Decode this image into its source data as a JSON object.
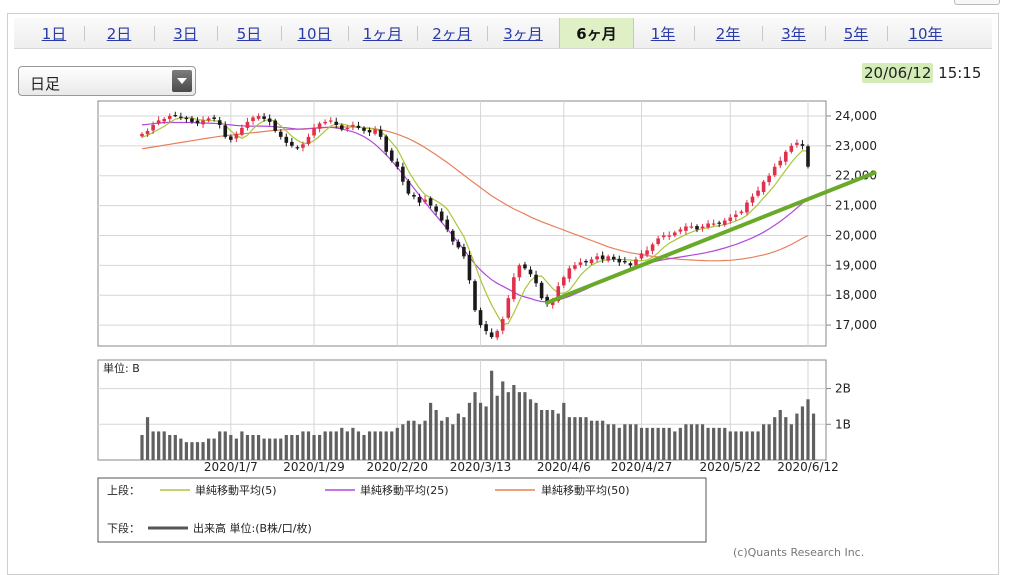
{
  "tabs": [
    {
      "label": "1日",
      "active": false
    },
    {
      "label": "2日",
      "active": false
    },
    {
      "label": "3日",
      "active": false
    },
    {
      "label": "5日",
      "active": false
    },
    {
      "label": "10日",
      "active": false
    },
    {
      "label": "1ヶ月",
      "active": false
    },
    {
      "label": "2ヶ月",
      "active": false
    },
    {
      "label": "3ヶ月",
      "active": false
    },
    {
      "label": "6ヶ月",
      "active": true
    },
    {
      "label": "1年",
      "active": false
    },
    {
      "label": "2年",
      "active": false
    },
    {
      "label": "3年",
      "active": false
    },
    {
      "label": "5年",
      "active": false
    },
    {
      "label": "10年",
      "active": false
    }
  ],
  "period_select": {
    "value": "日足"
  },
  "timestamp": {
    "date": "20/06/12",
    "time": "15:15"
  },
  "copyright": "(c)Quants Research Inc.",
  "colors": {
    "up_candle": "#e0304a",
    "down_candle": "#1a1a1a",
    "ma5": "#a8c83a",
    "ma25": "#b04ad8",
    "ma50": "#e8805a",
    "trendline": "#6aaa2a",
    "volume_bar": "#606060",
    "active_tab": "#dff0c6"
  },
  "legend": {
    "upper_label": "上段：",
    "lower_label": "下段：",
    "ma5_label": "単純移動平均(5)",
    "ma25_label": "単純移動平均(25)",
    "ma50_label": "単純移動平均(50)",
    "volume_label": "出来高 単位:(B株/口/枚)"
  },
  "chart_data": [
    {
      "type": "candlestick",
      "ylim": [
        16300,
        24500
      ],
      "yticks": [
        "24,000",
        "23,000",
        "22,000",
        "21,000",
        "20,000",
        "19,000",
        "18,000",
        "17,000"
      ],
      "ytick_values": [
        24000,
        23000,
        22000,
        21000,
        20000,
        19000,
        18000,
        17000
      ],
      "xtick_labels": [
        "2020/1/7",
        "2020/1/29",
        "2020/2/20",
        "2020/3/13",
        "2020/4/6",
        "2020/4/27",
        "2020/5/22",
        "2020/6/12"
      ],
      "xtick_index": [
        16,
        31,
        46,
        61,
        76,
        90,
        106,
        120
      ],
      "series_close": [
        23400,
        23500,
        23700,
        23850,
        23900,
        24000,
        24020,
        23950,
        23900,
        23800,
        23750,
        23850,
        23920,
        23900,
        23700,
        23300,
        23200,
        23400,
        23600,
        23800,
        23950,
        24000,
        23900,
        23800,
        23500,
        23300,
        23100,
        23000,
        22950,
        23050,
        23300,
        23600,
        23750,
        23800,
        23850,
        23700,
        23550,
        23600,
        23700,
        23600,
        23500,
        23450,
        23550,
        23300,
        22800,
        22500,
        22300,
        21800,
        21400,
        21300,
        21100,
        21200,
        21000,
        20800,
        20500,
        20200,
        19800,
        19600,
        19300,
        18500,
        17500,
        17000,
        16800,
        16600,
        16800,
        17200,
        17900,
        18600,
        19000,
        18900,
        18700,
        18400,
        17900,
        17700,
        17800,
        18300,
        18600,
        18900,
        19000,
        19100,
        19100,
        19200,
        19300,
        19200,
        19300,
        19200,
        19100,
        19100,
        19000,
        19200,
        19400,
        19500,
        19700,
        19900,
        20000,
        20000,
        20100,
        20200,
        20300,
        20300,
        20200,
        20300,
        20400,
        20400,
        20400,
        20500,
        20600,
        20700,
        20800,
        21100,
        21300,
        21500,
        21800,
        22000,
        22300,
        22500,
        22800,
        23000,
        23100,
        23000,
        22300
      ],
      "ma5": [
        23300,
        23350,
        23450,
        23550,
        23650,
        23780,
        23890,
        23930,
        23950,
        23930,
        23880,
        23860,
        23840,
        23840,
        23820,
        23690,
        23500,
        23350,
        23250,
        23350,
        23570,
        23730,
        23840,
        23880,
        23820,
        23670,
        23500,
        23320,
        23180,
        23090,
        23080,
        23170,
        23330,
        23500,
        23660,
        23740,
        23730,
        23690,
        23650,
        23630,
        23600,
        23570,
        23560,
        23480,
        23320,
        23110,
        22890,
        22540,
        22160,
        21860,
        21580,
        21360,
        21260,
        21160,
        21040,
        20880,
        20580,
        20270,
        19960,
        19500,
        19030,
        18510,
        18070,
        17680,
        17340,
        17020,
        17060,
        17400,
        17810,
        18210,
        18480,
        18640,
        18640,
        18440,
        18220,
        18080,
        18060,
        18160,
        18410,
        18670,
        18850,
        19000,
        19100,
        19160,
        19190,
        19200,
        19200,
        19190,
        19180,
        19150,
        19150,
        19180,
        19270,
        19420,
        19600,
        19740,
        19840,
        19940,
        20030,
        20110,
        20180,
        20230,
        20260,
        20300,
        20330,
        20360,
        20420,
        20480,
        20560,
        20670,
        20860,
        21040,
        21260,
        21460,
        21680,
        21940,
        22190,
        22440,
        22660,
        22840,
        22820
      ],
      "ma25": [
        23700,
        23720,
        23740,
        23760,
        23780,
        23780,
        23780,
        23780,
        23780,
        23780,
        23770,
        23760,
        23760,
        23750,
        23740,
        23720,
        23700,
        23680,
        23670,
        23660,
        23660,
        23660,
        23660,
        23650,
        23640,
        23620,
        23600,
        23580,
        23560,
        23560,
        23570,
        23590,
        23610,
        23620,
        23620,
        23600,
        23560,
        23520,
        23470,
        23400,
        23310,
        23190,
        23050,
        22880,
        22700,
        22500,
        22280,
        22050,
        21820,
        21580,
        21340,
        21110,
        20880,
        20660,
        20440,
        20220,
        19990,
        19760,
        19520,
        19280,
        19040,
        18840,
        18670,
        18520,
        18400,
        18300,
        18200,
        18100,
        18000,
        17940,
        17890,
        17830,
        17790,
        17780,
        17800,
        17840,
        17900,
        17960,
        18040,
        18120,
        18200,
        18290,
        18380,
        18480,
        18570,
        18650,
        18730,
        18810,
        18880,
        18940,
        19000,
        19060,
        19110,
        19150,
        19190,
        19220,
        19250,
        19280,
        19310,
        19340,
        19370,
        19400,
        19440,
        19480,
        19530,
        19580,
        19640,
        19700,
        19770,
        19840,
        19920,
        20010,
        20110,
        20220,
        20340,
        20470,
        20610,
        20760,
        20920,
        21080,
        21230
      ],
      "ma50": [
        22900,
        22930,
        22960,
        22990,
        23020,
        23050,
        23080,
        23110,
        23140,
        23170,
        23200,
        23230,
        23260,
        23290,
        23320,
        23340,
        23360,
        23380,
        23400,
        23420,
        23440,
        23460,
        23480,
        23500,
        23520,
        23530,
        23540,
        23550,
        23560,
        23570,
        23580,
        23590,
        23600,
        23610,
        23620,
        23630,
        23630,
        23630,
        23630,
        23620,
        23610,
        23590,
        23570,
        23540,
        23500,
        23450,
        23390,
        23320,
        23240,
        23150,
        23050,
        22940,
        22820,
        22700,
        22570,
        22440,
        22300,
        22160,
        22020,
        21880,
        21740,
        21600,
        21460,
        21330,
        21210,
        21100,
        20990,
        20890,
        20800,
        20710,
        20620,
        20540,
        20460,
        20390,
        20320,
        20250,
        20180,
        20110,
        20040,
        19970,
        19900,
        19830,
        19760,
        19690,
        19620,
        19560,
        19510,
        19460,
        19420,
        19390,
        19360,
        19330,
        19300,
        19280,
        19260,
        19240,
        19220,
        19200,
        19190,
        19180,
        19170,
        19160,
        19150,
        19150,
        19150,
        19160,
        19170,
        19190,
        19210,
        19240,
        19270,
        19310,
        19350,
        19400,
        19460,
        19530,
        19610,
        19700,
        19800,
        19900,
        20000
      ],
      "trendline": {
        "from": {
          "index": 73,
          "value": 17750
        },
        "to": {
          "index": 132,
          "value": 22100
        }
      }
    },
    {
      "type": "bar",
      "title": "単位: B",
      "ylim": [
        0,
        2.8
      ],
      "yticks": [
        "2B",
        "1B"
      ],
      "ytick_values": [
        2,
        1
      ],
      "values": [
        0.7,
        1.2,
        0.8,
        0.8,
        0.8,
        0.7,
        0.7,
        0.6,
        0.5,
        0.5,
        0.5,
        0.5,
        0.6,
        0.6,
        0.8,
        0.8,
        0.7,
        0.6,
        0.8,
        0.7,
        0.7,
        0.7,
        0.6,
        0.6,
        0.6,
        0.6,
        0.7,
        0.7,
        0.7,
        0.8,
        0.8,
        0.7,
        0.7,
        0.8,
        0.8,
        0.8,
        0.9,
        0.8,
        0.9,
        0.8,
        0.7,
        0.8,
        0.8,
        0.8,
        0.8,
        0.8,
        0.9,
        1.0,
        1.1,
        1.1,
        1.0,
        1.1,
        1.6,
        1.4,
        1.1,
        1.2,
        1.0,
        1.3,
        1.2,
        1.6,
        1.9,
        1.6,
        1.5,
        2.5,
        1.8,
        2.2,
        1.9,
        2.1,
        1.9,
        1.9,
        1.7,
        1.6,
        1.4,
        1.4,
        1.4,
        1.3,
        1.6,
        1.2,
        1.2,
        1.2,
        1.2,
        1.1,
        1.1,
        1.1,
        1.0,
        1.0,
        0.9,
        1.0,
        1.0,
        1.0,
        0.9,
        0.9,
        0.9,
        0.9,
        0.9,
        0.9,
        0.8,
        0.9,
        1.0,
        1.0,
        1.0,
        1.0,
        0.9,
        0.9,
        0.9,
        0.9,
        0.8,
        0.8,
        0.8,
        0.8,
        0.8,
        0.8,
        1.0,
        1.0,
        1.2,
        1.4,
        1.2,
        1.0,
        1.3,
        1.5,
        1.7,
        1.3
      ]
    }
  ]
}
